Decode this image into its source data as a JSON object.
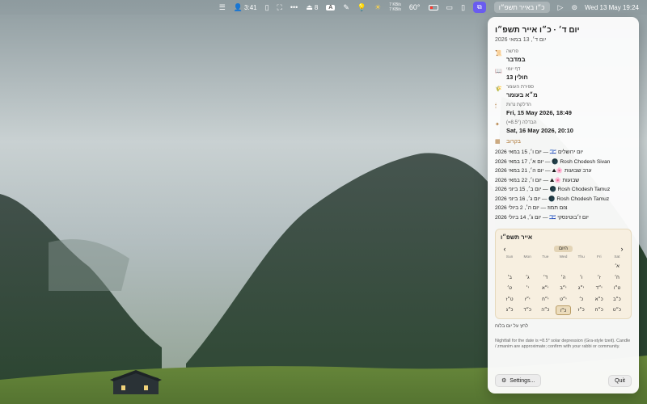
{
  "menubar": {
    "items": [
      {
        "name": "control-strip-icon",
        "glyph": "☰"
      },
      {
        "name": "user-battery-status",
        "glyph": "👤",
        "text": "3:41"
      },
      {
        "name": "clipboard-icon",
        "glyph": "▯"
      },
      {
        "name": "expand-icon",
        "glyph": "⛶"
      },
      {
        "name": "more-icon",
        "glyph": "•••"
      },
      {
        "name": "eject-status",
        "glyph": "⏏",
        "text": "8"
      },
      {
        "name": "input-source-icon",
        "glyph": "A"
      },
      {
        "name": "brush-icon",
        "glyph": "✎"
      },
      {
        "name": "lightbulb-icon",
        "glyph": "💡"
      },
      {
        "name": "weather-sun-icon",
        "glyph": "☀"
      }
    ],
    "network": {
      "up": "7 KB/s",
      "down": "7 KB/s"
    },
    "temperature": "60°",
    "menu_active_icon": "window-stack-icon",
    "hebrew_date": "כ״ו באייר תשפ״ו",
    "clock": "Wed 13 May  19:24"
  },
  "panel": {
    "title": "יום ד׳ · כ״ו אייר תשפ״ו",
    "subtitle": "יום ד׳, 13 במאי 2026",
    "sections": [
      {
        "icon": "scroll-icon",
        "glyph": "📜",
        "label": "פרשה",
        "value": "במדבר",
        "ltr": false
      },
      {
        "icon": "book-icon",
        "glyph": "📖",
        "label": "דף יומי",
        "value": "חולין 13",
        "ltr": false
      },
      {
        "icon": "omer-icon",
        "glyph": "🌾",
        "label": "ספירת העומר",
        "value": "מ״א בעומר",
        "ltr": false
      },
      {
        "icon": "candle-icon",
        "glyph": "🕯",
        "label": "הדלקת נרות",
        "value": "Fri, 15 May 2026, 18:49",
        "ltr": true
      },
      {
        "icon": "havdalah-icon",
        "glyph": "✦",
        "label": "הבדלה (8.5°=)",
        "value": "Sat, 16 May 2026, 20:10",
        "ltr": true
      }
    ],
    "upcoming_label": "בקרוב",
    "upcoming": [
      "יום ירושלים 🇮🇱 — יום ו׳, 15 במאי 2026",
      "Rosh Chodesh Sivan 🌑 — יום א׳, 17 במאי 2026",
      "ערב שבועות 🌸⛰ — יום ה׳, 21 במאי 2026",
      "שבועות 🌸⛰ — יום ו׳, 22 במאי 2026",
      "Rosh Chodesh Tamuz 🌑 — יום ב׳, 15 ביוני 2026",
      "Rosh Chodesh Tamuz 🌑 — יום ג׳, 16 ביוני 2026",
      "צום תמוז — יום ה׳, 2 ביולי 2026",
      "יום ז׳בוטינסקי 🇮🇱 — יום ג׳, 14 ביולי 2026"
    ],
    "calendar": {
      "title": "אייר תשפ״ו",
      "today_button": "היום",
      "weekdays": [
        "Sun",
        "Mon",
        "Tue",
        "Wed",
        "Thu",
        "Fri",
        "Sat"
      ],
      "rows": [
        [
          "",
          "",
          "",
          "",
          "",
          "",
          "א׳"
        ],
        [
          "ב׳",
          "ג׳",
          "ד׳",
          "ה׳",
          "ו׳",
          "ז׳",
          "ח׳"
        ],
        [
          "ט׳",
          "י׳",
          "י״א",
          "י״ב",
          "י״ג",
          "י״ד",
          "ט״ו"
        ],
        [
          "ט״ז",
          "י״ז",
          "י״ח",
          "י״ט",
          "כ׳",
          "כ״א",
          "כ״ב"
        ],
        [
          "כ״ג",
          "כ״ד",
          "כ״ה",
          "כ״ו",
          "כ״ז",
          "כ״ח",
          "כ״ט"
        ]
      ],
      "today": "כ״ו",
      "hint": "לחץ על יום בלוח"
    },
    "disclaimer": "Nightfall for the date is ≈8.5° solar depression (Gra-style tzeit). Candle / zmanim are approximate; confirm with your rabbi or community.",
    "settings_label": "Settings...",
    "quit_label": "Quit"
  }
}
